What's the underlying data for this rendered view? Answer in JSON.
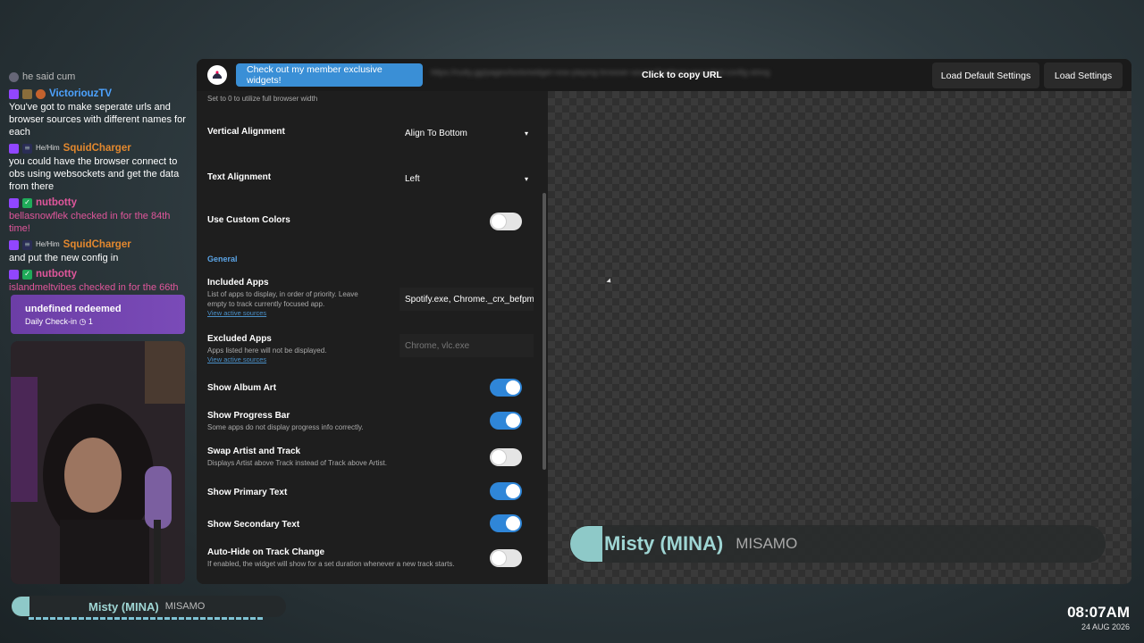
{
  "chat": {
    "messages": [
      {
        "user": "",
        "text": "he said cum",
        "pronoun": "",
        "color": "grey"
      },
      {
        "user": "VictoriouzTV",
        "text": "You've got to make seperate urls and browser sources with different names for each",
        "pronoun": "",
        "color": "blue"
      },
      {
        "user": "SquidCharger",
        "text": "you could have the browser connect to obs using websockets and get the data from there",
        "pronoun": "He/Him",
        "color": "orange"
      },
      {
        "user": "nutbotty",
        "text": "bellasnowflek checked in for the 84th time!",
        "pronoun": "",
        "color": "pink"
      },
      {
        "user": "SquidCharger",
        "text": "and put the new config in",
        "pronoun": "He/Him",
        "color": "orange"
      },
      {
        "user": "nutbotty",
        "text": "islandmeltvibes checked in for the 66th time!",
        "pronoun": "",
        "color": "pink"
      }
    ]
  },
  "redeem": {
    "title": "undefined redeemed",
    "subtitle": "Daily Check-in",
    "count": "1"
  },
  "now_playing_small": {
    "track": "Misty (MINA)",
    "artist": "MISAMO"
  },
  "clock": {
    "time": "08:07AM",
    "date": "24 AUG 2026"
  },
  "topbar": {
    "promo_label": "Check out my member exclusive widgets!",
    "url_text": "https://nutty.gg/pages/tools/widget-now-playing-browser-source?settings=encoded-config-string",
    "copy_label": "Click to copy URL",
    "load_default_label": "Load Default Settings",
    "load_label": "Load Settings"
  },
  "settings": {
    "width_desc": "Set to 0 to utilize full browser width",
    "vertical_alignment": {
      "label": "Vertical Alignment",
      "value": "Align To Bottom"
    },
    "text_alignment": {
      "label": "Text Alignment",
      "value": "Left"
    },
    "use_custom_colors": {
      "label": "Use Custom Colors"
    },
    "section_general": "General",
    "included_apps": {
      "label": "Included Apps",
      "desc": "List of apps to display, in order of priority. Leave empty to track currently focused app.",
      "link": "View active sources",
      "value": "Spotify.exe, Chrome._crx_befpmc"
    },
    "excluded_apps": {
      "label": "Excluded Apps",
      "desc": "Apps listed here will not be displayed.",
      "link": "View active sources",
      "placeholder": "Chrome, vlc.exe"
    },
    "show_album_art": {
      "label": "Show Album Art"
    },
    "show_progress_bar": {
      "label": "Show Progress Bar",
      "desc": "Some apps do not display progress info correctly."
    },
    "swap_artist_track": {
      "label": "Swap Artist and Track",
      "desc": "Displays Artist above Track instead of Track above Artist."
    },
    "show_primary_text": {
      "label": "Show Primary Text"
    },
    "show_secondary_text": {
      "label": "Show Secondary Text"
    },
    "auto_hide": {
      "label": "Auto-Hide on Track Change",
      "desc": "If enabled, the widget will show for a set duration whenever a new track starts."
    }
  },
  "preview": {
    "track": "Misty (MINA)",
    "artist": "MISAMO"
  },
  "colors": {
    "accent": "#2f86d8",
    "promo": "#3a8fd6",
    "track_text": "#9fd6d4",
    "redeem": "#7a4bb8"
  }
}
